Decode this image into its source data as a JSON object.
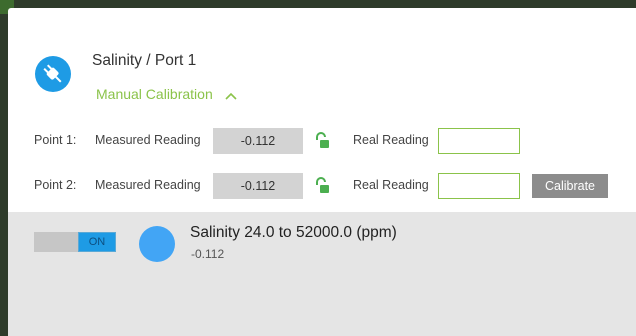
{
  "header": {
    "title": "Salinity / Port 1",
    "icon": "plug-icon",
    "accent_color": "#1e9be5"
  },
  "manual_calibration": {
    "label": "Manual Calibration",
    "expanded": true,
    "color": "#8bc34a"
  },
  "points": [
    {
      "label": "Point 1:",
      "measured_label": "Measured Reading",
      "measured_value": "-0.112",
      "lock_icon": "unlock-icon",
      "real_label": "Real Reading",
      "real_value": ""
    },
    {
      "label": "Point 2:",
      "measured_label": "Measured Reading",
      "measured_value": "-0.112",
      "lock_icon": "unlock-icon",
      "real_label": "Real Reading",
      "real_value": ""
    }
  ],
  "calibrate_button": {
    "label": "Calibrate"
  },
  "sensor": {
    "toggle_label": "ON",
    "toggle_on": true,
    "name": "Salinity 24.0 to 52000.0 (ppm)",
    "value": "-0.112",
    "status_color": "#42a5f5"
  }
}
